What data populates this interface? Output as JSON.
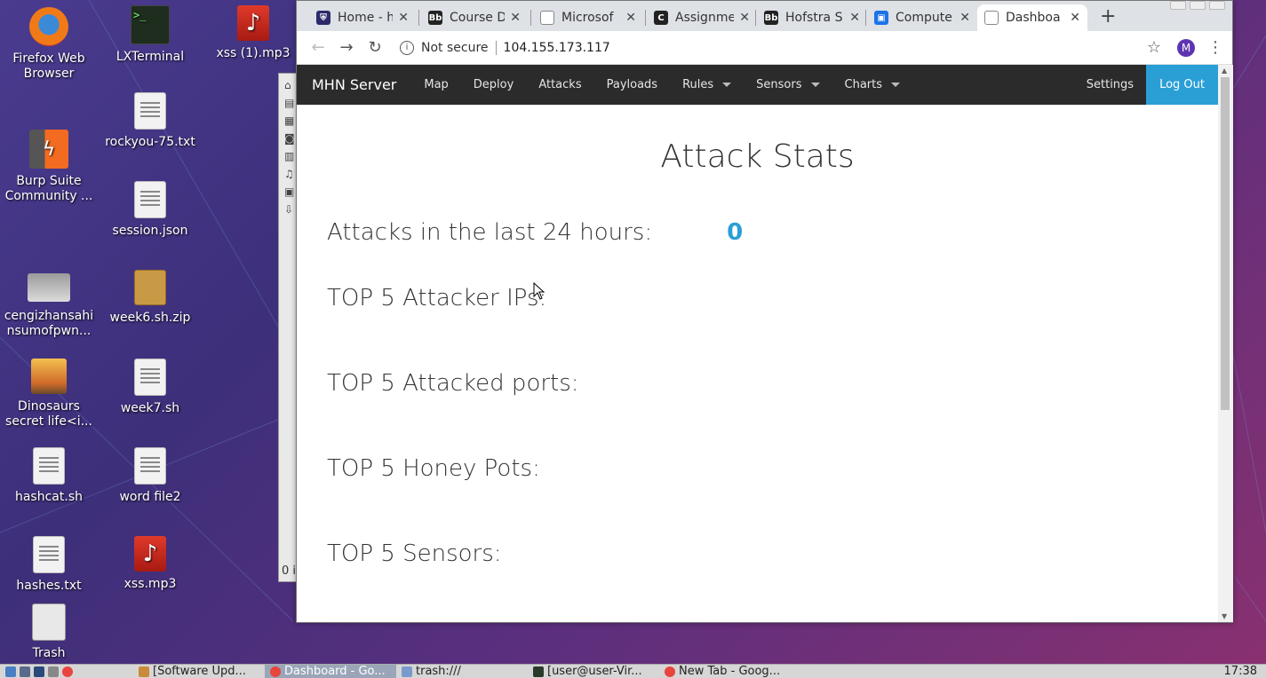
{
  "desktop": {
    "icons": [
      {
        "label": "Firefox Web Browser",
        "icon": "firefox-icon"
      },
      {
        "label": "LXTerminal",
        "icon": "terminal-icon"
      },
      {
        "label": "xss (1).mp3",
        "icon": "audio-file-icon"
      },
      {
        "label": "rockyou-75.txt",
        "icon": "text-file-icon"
      },
      {
        "label": "Burp Suite Community ...",
        "icon": "burp-suite-icon"
      },
      {
        "label": "session.json",
        "icon": "text-file-icon"
      },
      {
        "label": "cengizhansahinsumofpwn...",
        "icon": "image-file-icon"
      },
      {
        "label": "week6.sh.zip",
        "icon": "archive-icon"
      },
      {
        "label": "Dinosaurs secret life<i...",
        "icon": "image-file-icon"
      },
      {
        "label": "week7.sh",
        "icon": "text-file-icon"
      },
      {
        "label": "hashcat.sh",
        "icon": "text-file-icon"
      },
      {
        "label": "word file2",
        "icon": "text-file-icon"
      },
      {
        "label": "hashes.txt",
        "icon": "text-file-icon"
      },
      {
        "label": "xss.mp3",
        "icon": "audio-file-icon"
      },
      {
        "label": "Trash",
        "icon": "trash-icon"
      }
    ]
  },
  "browser": {
    "tabs": [
      {
        "title": "Home - h",
        "favicon_color": "#2b2b6b"
      },
      {
        "title": "Course D",
        "favicon_color": "#222222"
      },
      {
        "title": "Microsof",
        "favicon_color": "#888888"
      },
      {
        "title": "Assignme",
        "favicon_color": "#222222"
      },
      {
        "title": "Hofstra S",
        "favicon_color": "#222222"
      },
      {
        "title": "Compute",
        "favicon_color": "#1a73e8"
      },
      {
        "title": "Dashboa",
        "favicon_color": "#888888"
      }
    ],
    "active_tab_index": 6,
    "security_label": "Not secure",
    "url": "104.155.173.117",
    "profile_initial": "M"
  },
  "site": {
    "brand": "MHN Server",
    "nav": [
      {
        "label": "Map",
        "dropdown": false
      },
      {
        "label": "Deploy",
        "dropdown": false
      },
      {
        "label": "Attacks",
        "dropdown": false
      },
      {
        "label": "Payloads",
        "dropdown": false
      },
      {
        "label": "Rules",
        "dropdown": true
      },
      {
        "label": "Sensors",
        "dropdown": true
      },
      {
        "label": "Charts",
        "dropdown": true
      }
    ],
    "settings_label": "Settings",
    "logout_label": "Log Out",
    "accent_color": "#2a9fd6"
  },
  "main": {
    "title": "Attack Stats",
    "attacks_24h_label": "Attacks in the last 24 hours:",
    "attacks_24h_value": "0",
    "sections": [
      "TOP 5 Attacker IPs:",
      "TOP 5 Attacked ports:",
      "TOP 5 Honey Pots:",
      "TOP 5 Sensors:"
    ]
  },
  "taskbar": {
    "items": [
      {
        "label": "[Software Upd...",
        "active": false
      },
      {
        "label": "Dashboard - Go...",
        "active": true
      },
      {
        "label": "trash:///",
        "active": false
      },
      {
        "label": "[user@user-Vir...",
        "active": false
      },
      {
        "label": "New Tab - Goog...",
        "active": false
      }
    ],
    "clock": "17:38"
  },
  "background_window": {
    "status_text": "0 i"
  }
}
